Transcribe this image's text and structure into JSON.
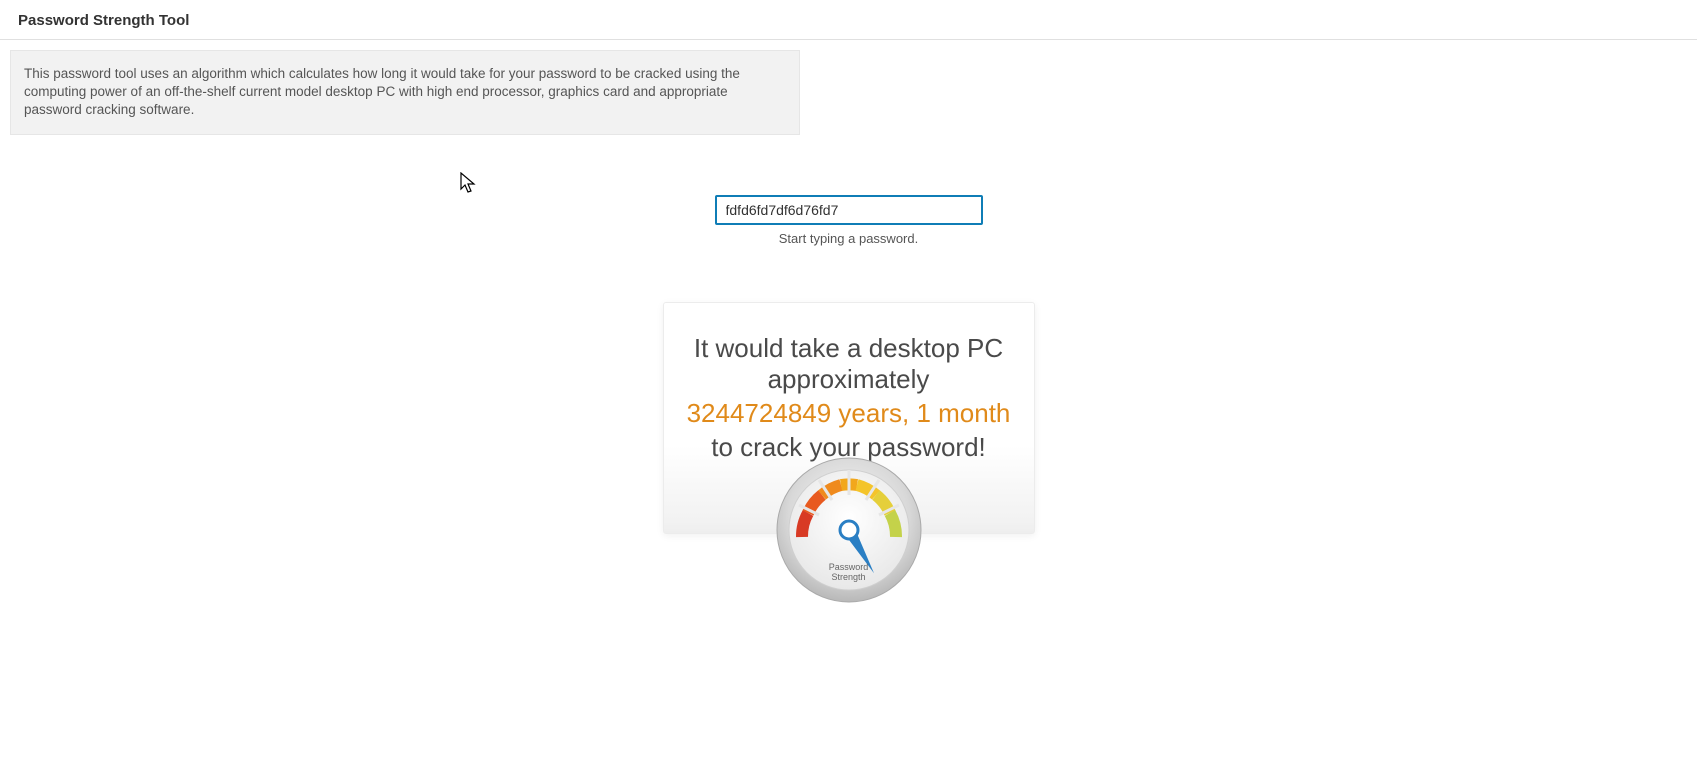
{
  "header": {
    "title": "Password Strength Tool"
  },
  "info": {
    "text": "This password tool uses an algorithm which calculates how long it would take for your password to be cracked using the computing power of an off-the-shelf current model desktop PC with high end processor, graphics card and appropriate password cracking software."
  },
  "input": {
    "value": "fdfd6fd7df6d76fd7",
    "hint": "Start typing a password."
  },
  "result": {
    "line1": "It would take a desktop PC approximately",
    "highlight": "3244724849 years, 1 month",
    "line2": "to crack your password!"
  },
  "gauge": {
    "label_top": "Password",
    "label_bottom": "Strength"
  }
}
